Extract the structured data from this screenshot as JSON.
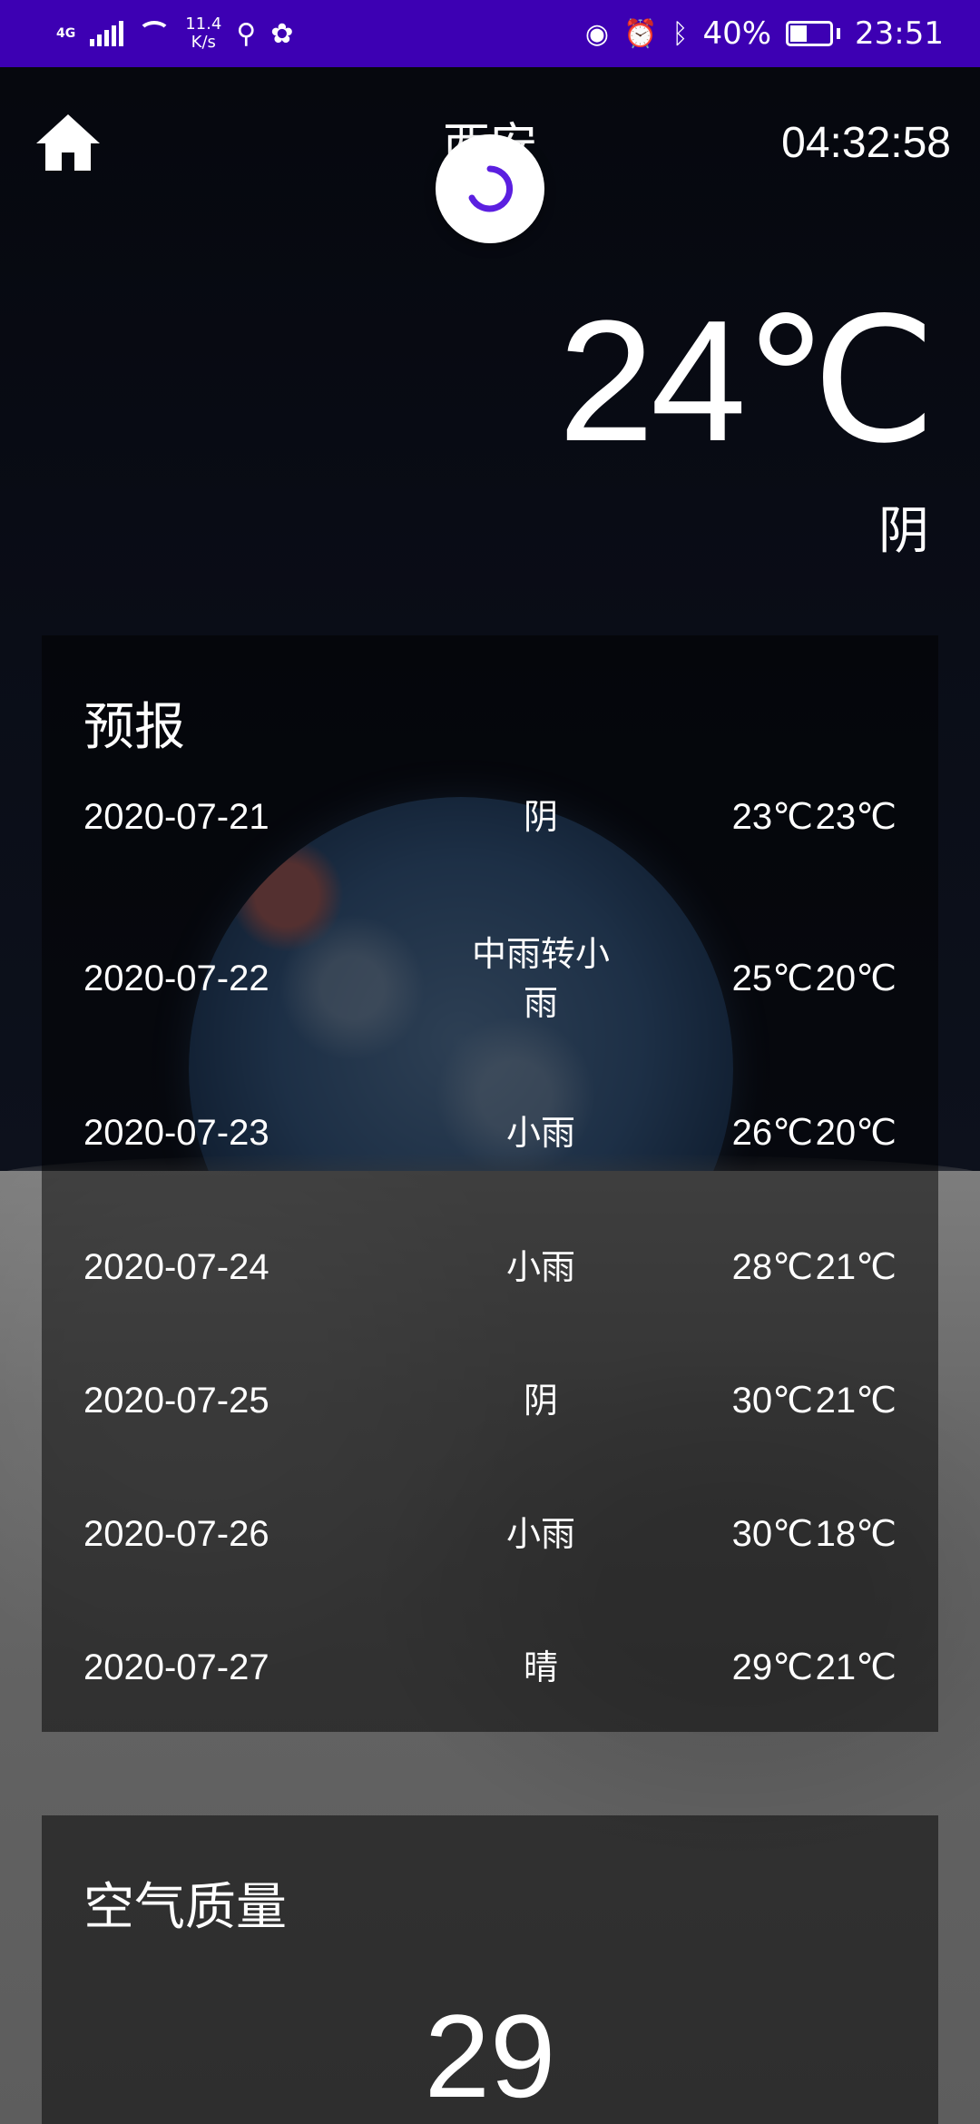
{
  "status_bar": {
    "network": "4G",
    "speed_value": "11.4",
    "speed_unit": "K/s",
    "battery_percent": "40%",
    "battery_level": 0.4,
    "time": "23:51"
  },
  "header": {
    "city": "西安",
    "time": "04:32:58"
  },
  "current": {
    "temperature": "24℃",
    "condition": "阴"
  },
  "forecast": {
    "title": "预报",
    "rows": [
      {
        "date": "2020-07-21",
        "condition": "阴",
        "max": "23℃",
        "min": "23℃"
      },
      {
        "date": "2020-07-22",
        "condition": "中雨转小雨",
        "max": "25℃",
        "min": "20℃"
      },
      {
        "date": "2020-07-23",
        "condition": "小雨",
        "max": "26℃",
        "min": "20℃"
      },
      {
        "date": "2020-07-24",
        "condition": "小雨",
        "max": "28℃",
        "min": "21℃"
      },
      {
        "date": "2020-07-25",
        "condition": "阴",
        "max": "30℃",
        "min": "21℃"
      },
      {
        "date": "2020-07-26",
        "condition": "小雨",
        "max": "30℃",
        "min": "18℃"
      },
      {
        "date": "2020-07-27",
        "condition": "晴",
        "max": "29℃",
        "min": "21℃"
      }
    ]
  },
  "air_quality": {
    "title": "空气质量",
    "aqi": "29"
  },
  "colors": {
    "status_bar": "#3d00b3",
    "spinner_accent": "#5b1fe0"
  }
}
